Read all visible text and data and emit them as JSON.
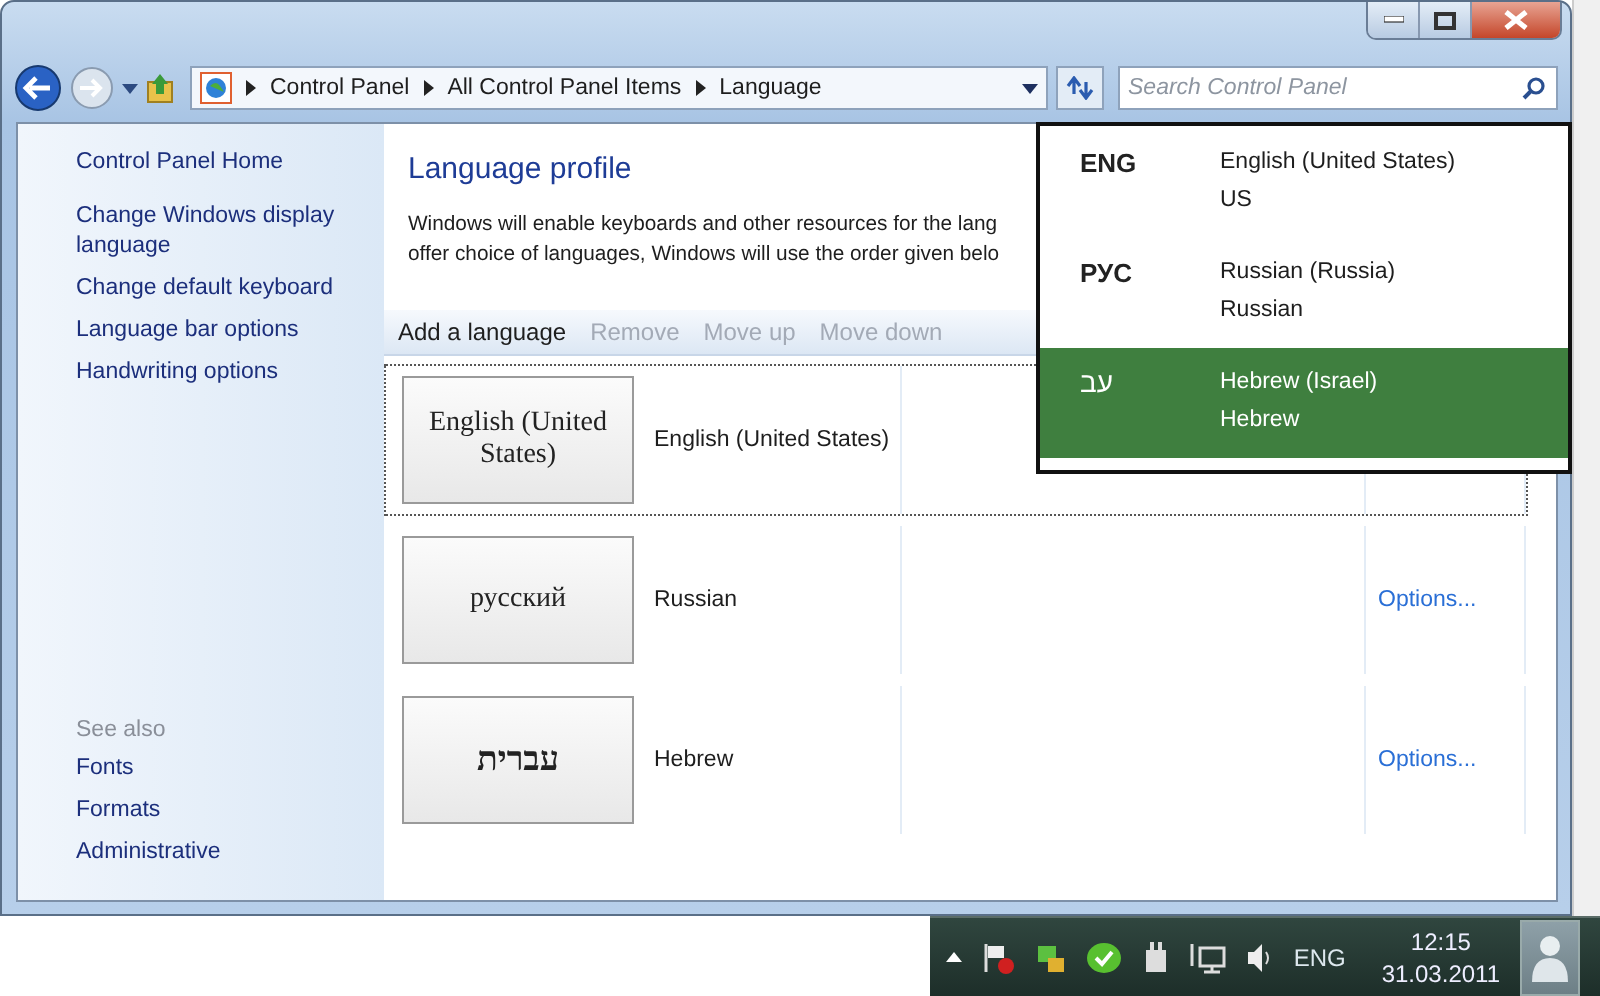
{
  "navigation": {
    "breadcrumb": [
      "Control Panel",
      "All Control Panel Items",
      "Language"
    ],
    "search": {
      "placeholder": "Search Control Panel"
    }
  },
  "sidebar": {
    "items": [
      "Control Panel Home",
      "Change Windows display language",
      "Change default keyboard",
      "Language bar options",
      "Handwriting options"
    ],
    "see_also": {
      "heading": "See also",
      "items": [
        "Fonts",
        "Formats",
        "Administrative"
      ]
    }
  },
  "main": {
    "title": "Language profile",
    "description": [
      "Windows will enable keyboards and other resources for the lang",
      "offer choice of languages, Windows will use the order given belo"
    ],
    "toolbar": [
      {
        "label": "Add a language",
        "disabled": false
      },
      {
        "label": "Remove",
        "disabled": true
      },
      {
        "label": "Move up",
        "disabled": true
      },
      {
        "label": "Move down",
        "disabled": true
      }
    ],
    "languages": [
      {
        "preview": "English (United States)",
        "name": "English (United States)",
        "focused": true
      },
      {
        "preview": "русский",
        "name": "Russian",
        "options": "Options...",
        "focused": false
      },
      {
        "preview": "עברית",
        "name": "Hebrew",
        "options": "Options...",
        "focused": false
      }
    ]
  },
  "language_menu": [
    {
      "code": "ENG",
      "name": "English (United States)",
      "layout": "US",
      "selected": false
    },
    {
      "code": "РУС",
      "name": "Russian (Russia)",
      "layout": "Russian",
      "selected": false
    },
    {
      "code": "עב",
      "name": "Hebrew (Israel)",
      "layout": "Hebrew",
      "selected": true
    }
  ],
  "taskbar": {
    "language": "ENG",
    "time": "12:15",
    "date": "31.03.2011"
  }
}
